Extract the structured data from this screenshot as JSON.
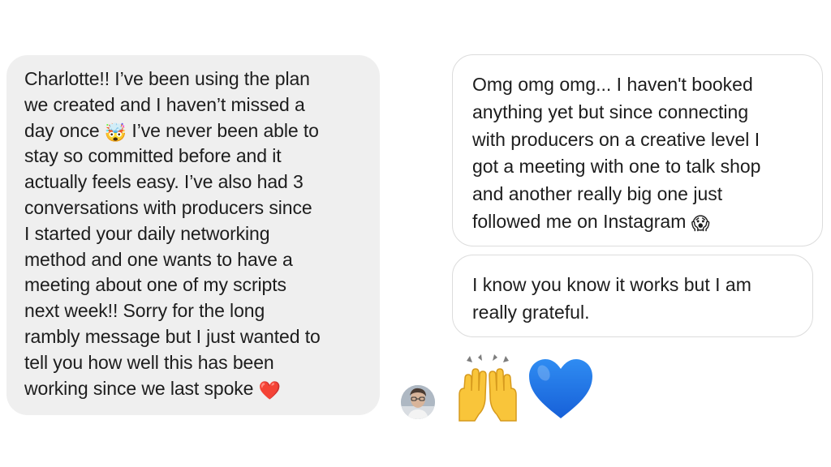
{
  "messages": {
    "left": {
      "text_main": "Charlotte!! I’ve been using the plan\nwe created and I haven’t missed a\nday once ",
      "emoji1": "🤯",
      "text_mid": " I’ve never been able to\nstay so committed before and it\nactually feels easy. I’ve also had 3\nconversations with producers since\nI started your daily networking\nmethod and one wants to have a\nmeeting about one of my scripts\nnext week!! Sorry for the long\nrambly message but I just wanted to\ntell you how well this has been\nworking since we last spoke ",
      "emoji2": "❤️"
    },
    "right1": {
      "text": "Omg omg omg... I haven't booked\nanything yet but since connecting\nwith producers on a creative level I\ngot a meeting with one to talk shop\nand another really big one just\nfollowed me on Instagram ",
      "emoji": "😱"
    },
    "right2": {
      "text": "I know you know it works but I am\nreally grateful."
    },
    "reactions": {
      "raising_hands": "🙌",
      "blue_heart": "💙"
    }
  },
  "colors": {
    "left_bubble_bg": "#efefef",
    "right_bubble_border": "#dcdcdc",
    "heart_blue": "#1f7ae8",
    "hands_yellow": "#f9c53a"
  }
}
